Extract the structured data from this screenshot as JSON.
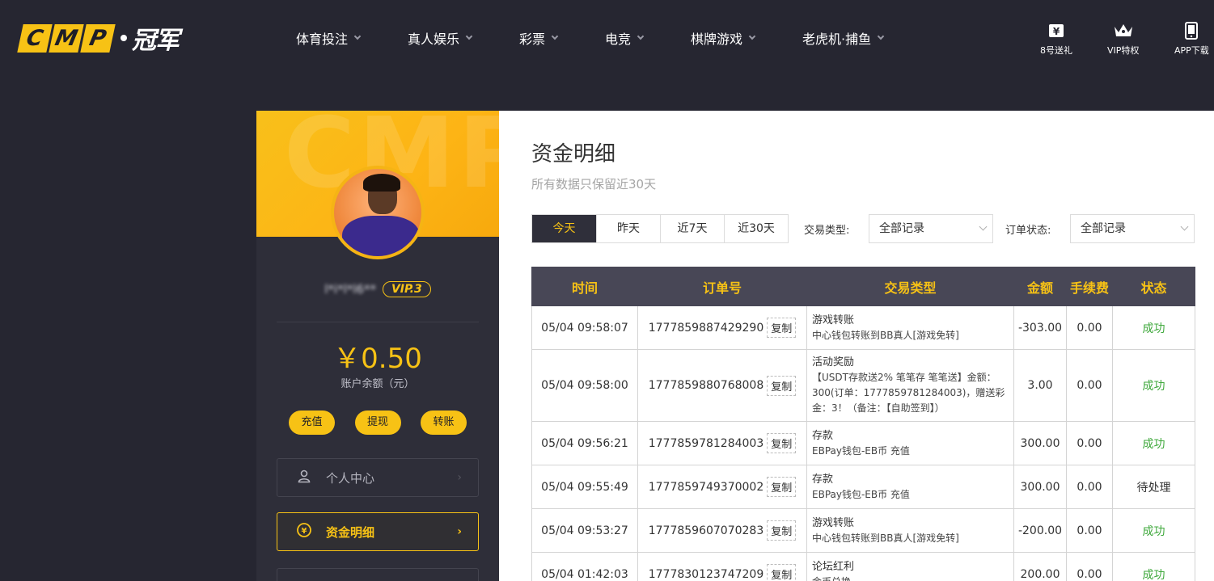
{
  "header": {
    "logo_letters": [
      "C",
      "M",
      "P"
    ],
    "logo_text": "冠军",
    "nav": [
      {
        "label": "体育投注"
      },
      {
        "label": "真人娱乐"
      },
      {
        "label": "彩票"
      },
      {
        "label": "电竞"
      },
      {
        "label": "棋牌游戏"
      },
      {
        "label": "老虎机·捕鱼"
      }
    ],
    "top_icons": [
      {
        "label": "8号送礼",
        "icon": "gift-yen-icon"
      },
      {
        "label": "VIP特权",
        "icon": "crown-icon"
      },
      {
        "label": "APP下载",
        "icon": "phone-icon"
      }
    ]
  },
  "sidebar": {
    "banner_watermark": "CMP",
    "username": "l*i*l*l6**",
    "vip": "VIP.3",
    "balance": "￥0.50",
    "balance_label": "账户余额（元）",
    "actions": [
      "充值",
      "提现",
      "转账"
    ],
    "menu": [
      {
        "label": "个人中心",
        "icon": "user-icon",
        "active": false
      },
      {
        "label": "资金明细",
        "icon": "yen-circle-icon",
        "active": true
      }
    ]
  },
  "main": {
    "title": "资金明细",
    "subtitle": "所有数据只保留近30天",
    "range_tabs": [
      {
        "label": "今天",
        "active": true
      },
      {
        "label": "昨天",
        "active": false
      },
      {
        "label": "近7天",
        "active": false
      },
      {
        "label": "近30天",
        "active": false
      }
    ],
    "filters": {
      "type_label": "交易类型:",
      "type_value": "全部记录",
      "status_label": "订单状态:",
      "status_value": "全部记录"
    },
    "table": {
      "columns": [
        "时间",
        "订单号",
        "交易类型",
        "金额",
        "手续费",
        "状态"
      ],
      "copy_label": "复制",
      "rows": [
        {
          "time": "05/04 09:58:07",
          "order": "1777859887429290",
          "type": "游戏转账",
          "detail": "中心钱包转账到BB真人[游戏免转]",
          "amount": "-303.00",
          "fee": "0.00",
          "status": "成功",
          "status_ok": true
        },
        {
          "time": "05/04 09:58:00",
          "order": "1777859880768008",
          "type": "活动奖励",
          "detail": "【USDT存款送2% 笔笔存 笔笔送】金额：300(订单：1777859781284003)，赠送彩金：3！（备注：【自助签到】）",
          "amount": "3.00",
          "fee": "0.00",
          "status": "成功",
          "status_ok": true
        },
        {
          "time": "05/04 09:56:21",
          "order": "1777859781284003",
          "type": "存款",
          "detail": "EBPay钱包-EB币 充值",
          "amount": "300.00",
          "fee": "0.00",
          "status": "成功",
          "status_ok": true
        },
        {
          "time": "05/04 09:55:49",
          "order": "1777859749370002",
          "type": "存款",
          "detail": "EBPay钱包-EB币 充值",
          "amount": "300.00",
          "fee": "0.00",
          "status": "待处理",
          "status_ok": false
        },
        {
          "time": "05/04 09:53:27",
          "order": "1777859607070283",
          "type": "游戏转账",
          "detail": "中心钱包转账到BB真人[游戏免转]",
          "amount": "-200.00",
          "fee": "0.00",
          "status": "成功",
          "status_ok": true
        },
        {
          "time": "05/04 01:42:03",
          "order": "1777830123747209",
          "type": "论坛红利",
          "detail": "金币兑换",
          "amount": "200.00",
          "fee": "0.00",
          "status": "成功",
          "status_ok": true
        }
      ]
    }
  },
  "colors": {
    "brand_yellow": "#f7c215",
    "dark_bg": "#262631",
    "table_header": "#484756",
    "success_green": "#3ea83b"
  }
}
